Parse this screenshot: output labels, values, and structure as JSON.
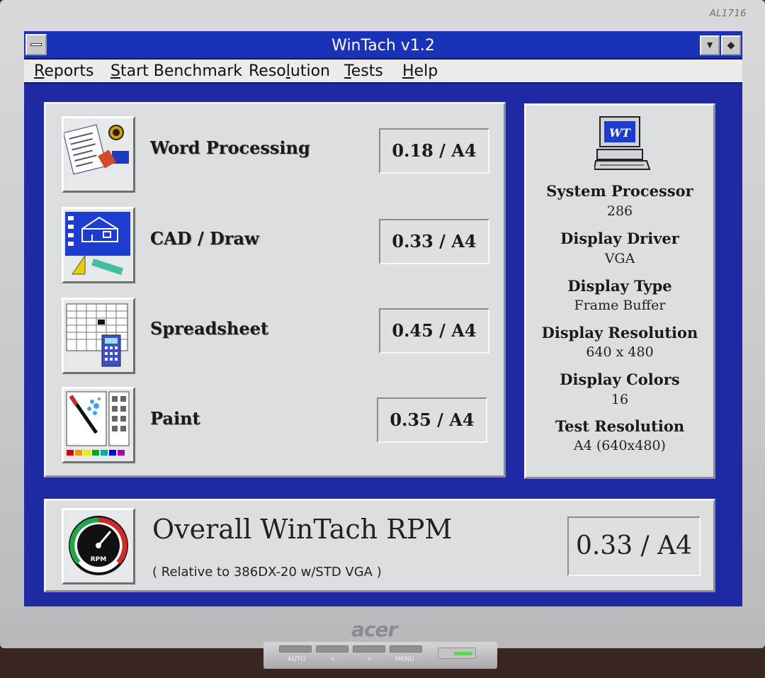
{
  "monitor": {
    "model": "AL1716",
    "brand": "acer",
    "buttons": [
      "AUTO",
      "<",
      ">",
      "MENU"
    ]
  },
  "window": {
    "title": "WinTach v1.2",
    "minimize_glyph": "▼",
    "restore_glyph": "◆"
  },
  "menu": {
    "items": [
      {
        "accel": "R",
        "rest": "eports"
      },
      {
        "accel": "S",
        "rest": "tart Benchmark"
      },
      {
        "pre": "Reso",
        "accel": "l",
        "rest": "ution"
      },
      {
        "accel": "T",
        "rest": "ests"
      },
      {
        "accel": "H",
        "rest": "elp"
      }
    ]
  },
  "tests": [
    {
      "label": "Word Processing",
      "value": "0.18 / A4",
      "icon": "word-processing-icon"
    },
    {
      "label": "CAD / Draw",
      "value": "0.33 / A4",
      "icon": "cad-draw-icon"
    },
    {
      "label": "Spreadsheet",
      "value": "0.45 / A4",
      "icon": "spreadsheet-icon"
    },
    {
      "label": "Paint",
      "value": "0.35 / A4",
      "icon": "paint-icon"
    }
  ],
  "system": {
    "logo_text": "WT",
    "fields": [
      {
        "label": "System Processor",
        "value": "286"
      },
      {
        "label": "Display Driver",
        "value": "VGA"
      },
      {
        "label": "Display Type",
        "value": "Frame Buffer"
      },
      {
        "label": "Display Resolution",
        "value": "640 x 480"
      },
      {
        "label": "Display Colors",
        "value": "16"
      },
      {
        "label": "Test Resolution",
        "value": "A4 (640x480)"
      }
    ]
  },
  "overall": {
    "title": "Overall WinTach RPM",
    "subtitle": "( Relative to 386DX-20 w/STD VGA )",
    "value": "0.33 / A4",
    "gauge_label": "RPM"
  },
  "colors": {
    "screen_bg": "#1f2aa4",
    "titlebar": "#1932b8",
    "panel": "#dcdfe2"
  }
}
